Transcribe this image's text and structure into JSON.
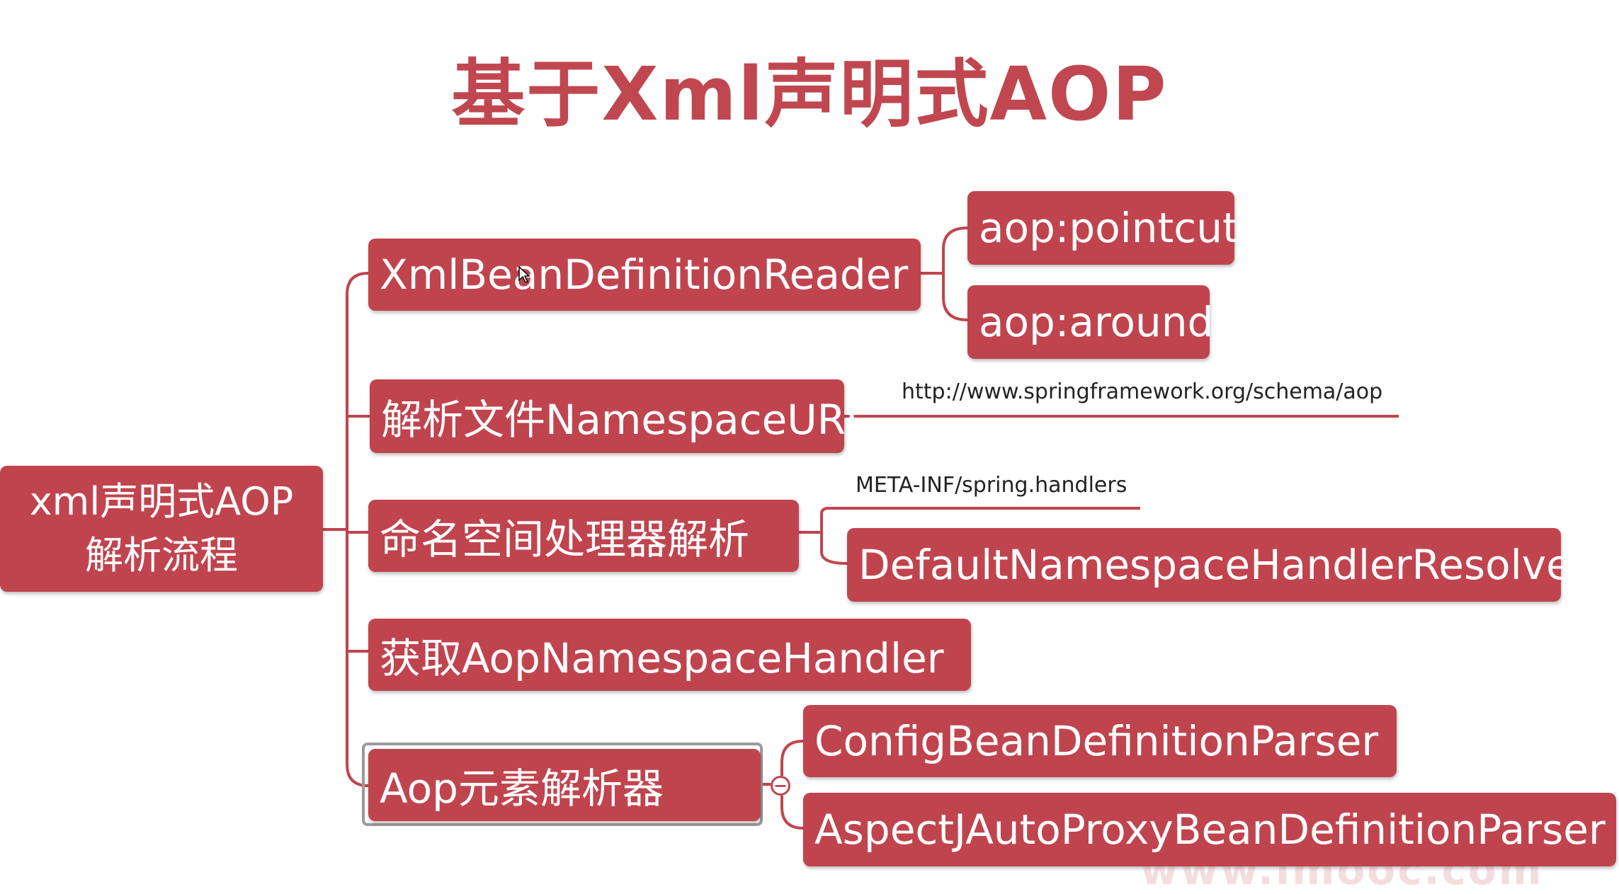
{
  "title": "基于Xml声明式AOP",
  "root": {
    "line1": "xml声明式AOP",
    "line2": "解析流程"
  },
  "nodes": {
    "reader": "XmlBeanDefinitionReader",
    "pointcut": "aop:pointcut",
    "around": "aop:around",
    "namespace_uri": "解析文件NamespaceURI",
    "namespace_uri_note": "http://www.springframework.org/schema/aop",
    "handler_resolve": "命名空间处理器解析",
    "handler_note": "META-INF/spring.handlers",
    "resolver": "DefaultNamespaceHandlerResolver",
    "get_handler": "获取AopNamespaceHandler",
    "element_parser": "Aop元素解析器",
    "config_parser": "ConfigBeanDefinitionParser",
    "aspectj_parser": "AspectJAutoProxyBeanDefinitionParser"
  },
  "collapse_symbol": "−",
  "watermark": "www.imooc.com",
  "colors": {
    "accent": "#c0444e",
    "title": "#c0474f",
    "background": "#ffffff"
  }
}
